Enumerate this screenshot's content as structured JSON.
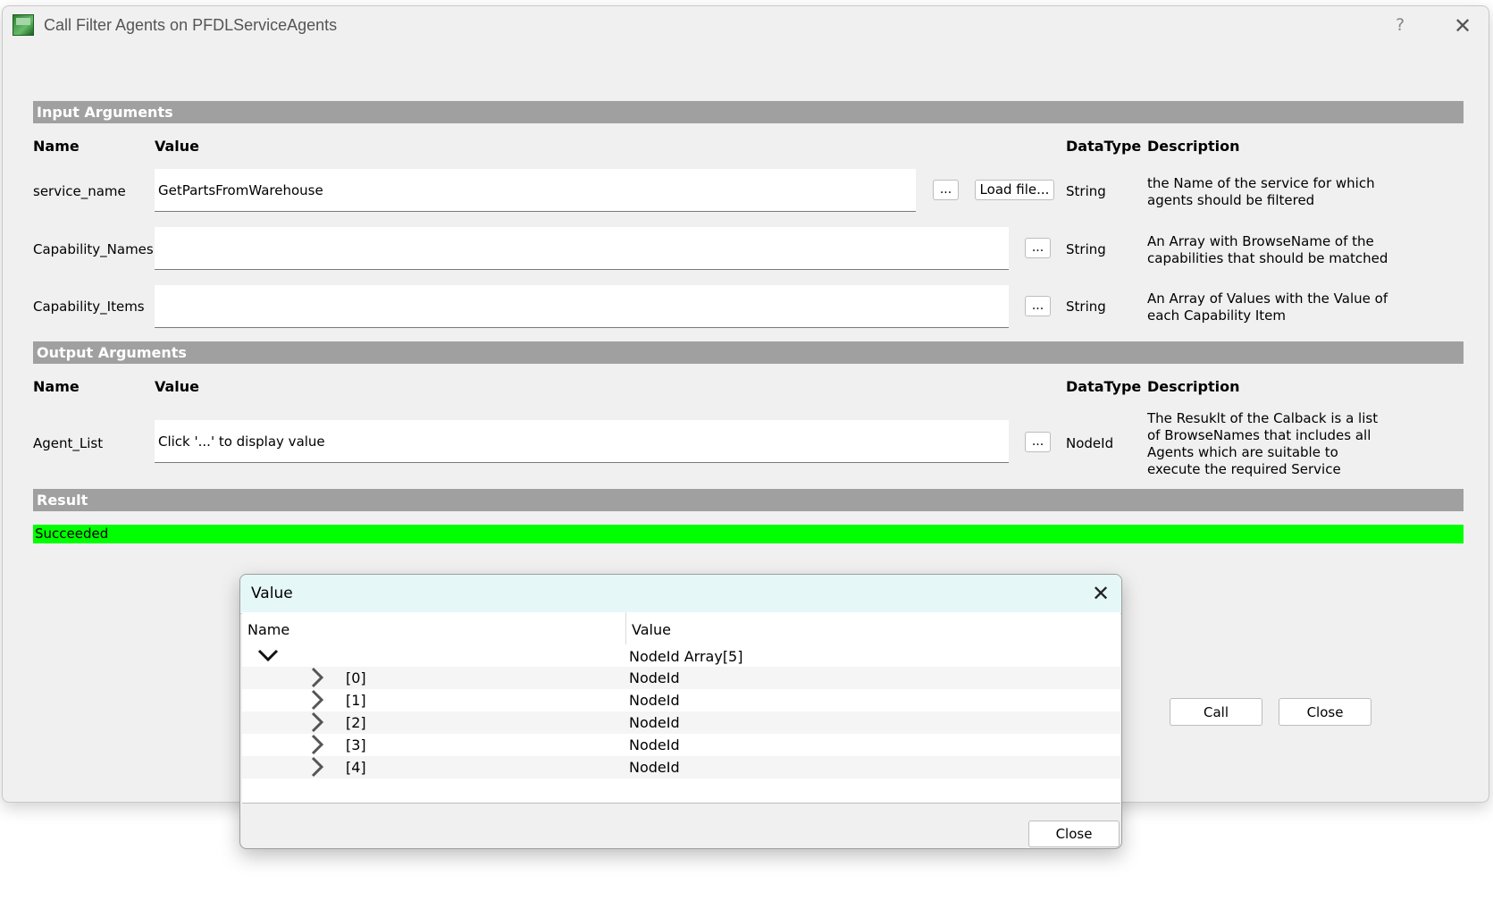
{
  "window": {
    "title": "Call Filter Agents on PFDLServiceAgents",
    "help_glyph": "?",
    "close_glyph": "✕"
  },
  "input": {
    "section_label": "Input Arguments",
    "headers": {
      "name": "Name",
      "value": "Value",
      "datatype": "DataType",
      "description": "Description"
    },
    "rows": [
      {
        "name": "service_name",
        "value": "GetPartsFromWarehouse",
        "datatype": "String",
        "description": "the Name of the service for which agents should be filtered",
        "dots": "...",
        "load": "Load file..."
      },
      {
        "name": "Capability_Names",
        "value": "",
        "datatype": "String",
        "description": "An Array with BrowseName of the capabilities that should be matched",
        "dots": "..."
      },
      {
        "name": "Capability_Items",
        "value": "",
        "datatype": "String",
        "description": "An Array of Values with the Value of each Capability Item",
        "dots": "..."
      }
    ]
  },
  "output": {
    "section_label": "Output Arguments",
    "headers": {
      "name": "Name",
      "value": "Value",
      "datatype": "DataType",
      "description": "Description"
    },
    "rows": [
      {
        "name": "Agent_List",
        "value": "Click '...' to display value",
        "datatype": "NodeId",
        "description": "The Resuklt of the Calback is a list of BrowseNames that includes all Agents which are suitable to execute the required Service",
        "dots": "..."
      }
    ]
  },
  "result": {
    "section_label": "Result",
    "status": "Succeeded",
    "status_color": "#00ff00"
  },
  "actions": {
    "call": "Call",
    "close": "Close"
  },
  "popup": {
    "title": "Value",
    "close_glyph": "✕",
    "headers": {
      "name": "Name",
      "value": "Value"
    },
    "root": {
      "value": "NodeId Array[5]"
    },
    "items": [
      {
        "name": "[0]",
        "value": "NodeId"
      },
      {
        "name": "[1]",
        "value": "NodeId"
      },
      {
        "name": "[2]",
        "value": "NodeId"
      },
      {
        "name": "[3]",
        "value": "NodeId"
      },
      {
        "name": "[4]",
        "value": "NodeId"
      }
    ],
    "close_button": "Close"
  }
}
